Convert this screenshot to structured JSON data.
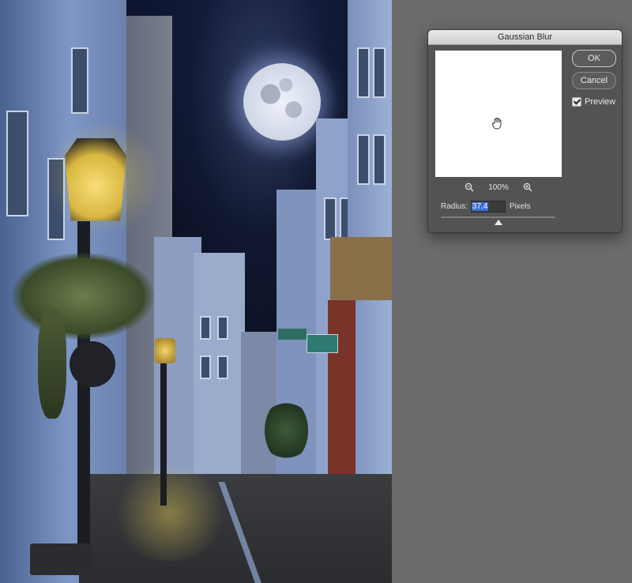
{
  "dialog": {
    "title": "Gaussian Blur",
    "ok_label": "OK",
    "cancel_label": "Cancel",
    "preview_label": "Preview",
    "preview_checked": true,
    "zoom_level": "100%",
    "zoom_out_icon": "zoom-out-icon",
    "zoom_in_icon": "zoom-in-icon",
    "cursor_icon": "hand-icon",
    "radius_label": "Radius:",
    "radius_value": "37.4",
    "radius_unit": "Pixels",
    "radius_slider_level": 0.5
  },
  "canvas": {
    "subject": "night street scene with moon and lit street lamps"
  }
}
